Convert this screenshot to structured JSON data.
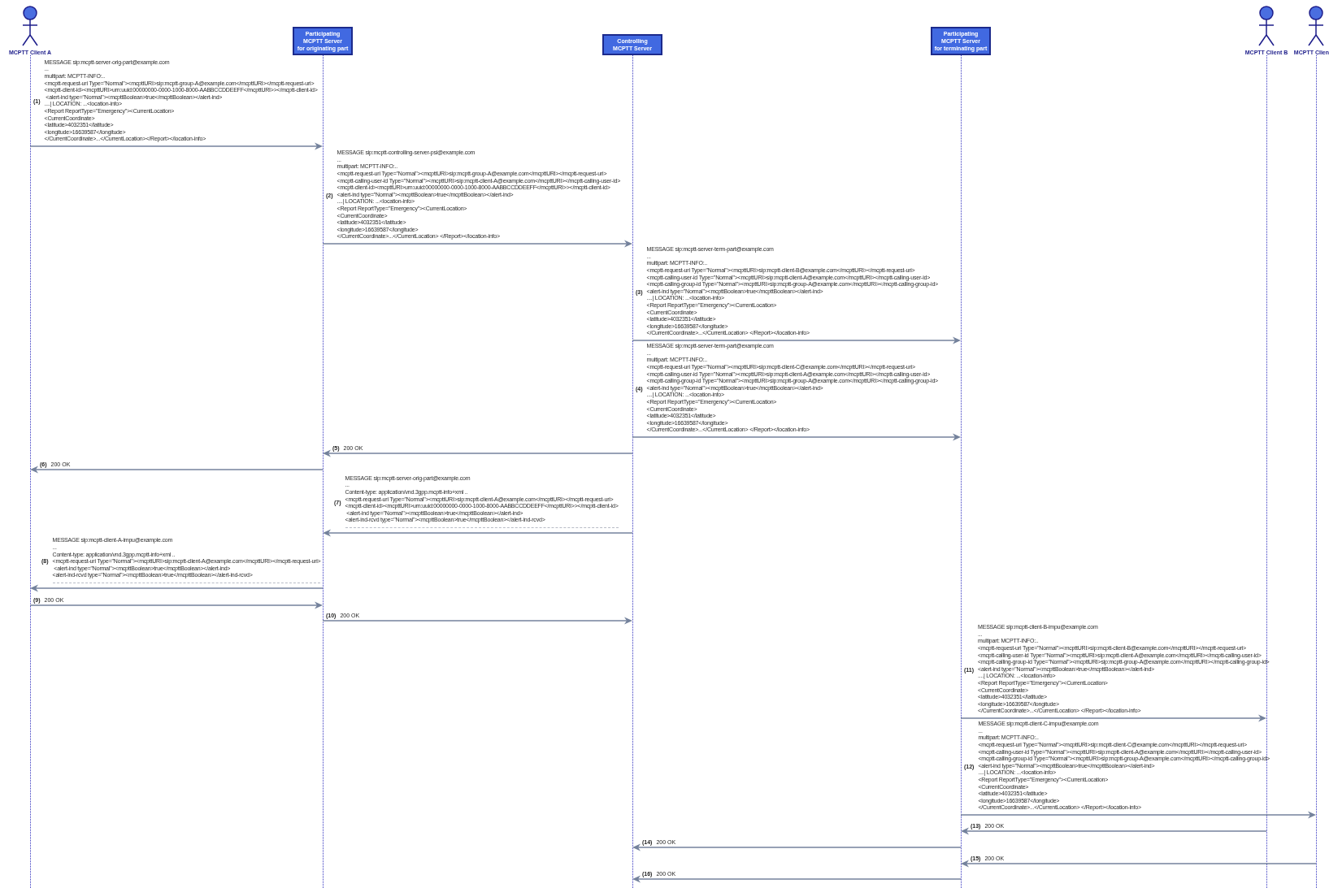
{
  "participants": [
    {
      "kind": "actor",
      "label_lines": [
        "MCPTT Client A"
      ]
    },
    {
      "kind": "server",
      "label_lines": [
        "Participating",
        "MCPTT Server",
        "for originating part"
      ]
    },
    {
      "kind": "server",
      "label_lines": [
        "Controlling",
        "MCPTT Server"
      ]
    },
    {
      "kind": "server",
      "label_lines": [
        "Participating",
        "MCPTT Server",
        "for terminating part"
      ]
    },
    {
      "kind": "actor",
      "label_lines": [
        "MCPTT Client B"
      ]
    },
    {
      "kind": "actor",
      "label_lines": [
        "MCPTT Clien"
      ]
    }
  ],
  "messages": [
    {
      "kind": "body",
      "number": "(1)",
      "cut_off": false,
      "lines": [
        "MESSAGE sip:mcptt-server-orig-part@example.com",
        "...",
        "multipart: MCPTT-INFO:..",
        "<mcptt-request-uri Type=\"Normal\"><mcpttURI>sip:mcptt-group-A@example.com</mcpttURI></mcptt-request-uri>",
        "<mcptt-client-id><mcpttURI>urn:uuid:00000000-0000-1000-8000-AABBCCDDEEFF</mcpttURI>></mcptt-client-id>",
        " <alert-ind type=\"Normal\"><mcpttBoolean>true</mcpttBoolean></alert-ind>",
        "....| LOCATION: ...<location-info>",
        "<Report ReportType=\"Emergency\"><CurrentLocation>",
        "<CurrentCoordinate>",
        "<latitude>4032351</latitude>",
        "<longitude>16639587</longitude>",
        "</CurrentCoordinate>...</CurrentLocation></Report></location-info>"
      ]
    },
    {
      "kind": "body",
      "number": "(2)",
      "cut_off": false,
      "lines": [
        "MESSAGE sip:mcptt-controlling-server-psi@example.com",
        "...",
        "multipart: MCPTT-INFO:..",
        "<mcptt-request-uri Type=\"Normal\"><mcpttURI>sip:mcptt-group-A@example.com</mcpttURI></mcptt-request-uri>",
        "<mcptt-calling-user-id Type=\"Normal\"><mcpttURI>sip:mcptt-client-A@example.com</mcpttURI></mcptt-calling-user-id>",
        "<mcptt-client-id><mcpttURI>urn:uuid:00000000-0000-1000-8000-AABBCCDDEEFF</mcpttURI>></mcptt-client-id>",
        "<alert-ind type=\"Normal\"><mcpttBoolean>true</mcpttBoolean></alert-ind>",
        "....| LOCATION: ...<location-info>",
        "<Report ReportType=\"Emergency\"><CurrentLocation>",
        "<CurrentCoordinate>",
        "<latitude>4032351</latitude>",
        "<longitude>16639587</longitude>",
        "</CurrentCoordinate>...</CurrentLocation> </Report></location-info>"
      ]
    },
    {
      "kind": "body",
      "number": "(3)",
      "cut_off": false,
      "lines": [
        "MESSAGE sip:mcptt-server-term-part@example.com",
        "...",
        "multipart: MCPTT-INFO:..",
        "<mcptt-request-uri Type=\"Normal\"><mcpttURI>sip:mcptt-client-B@example.com</mcpttURI></mcptt-request-uri>",
        "<mcptt-calling-user-id Type=\"Normal\"><mcpttURI>sip:mcptt-client-A@example.com</mcpttURI></mcptt-calling-user-id>",
        "<mcptt-calling-group-id Type=\"Normal\"><mcpttURI>sip:mcptt-group-A@example.com</mcpttURI></mcptt-calling-group-id>",
        "<alert-ind type=\"Normal\"><mcpttBoolean>true</mcpttBoolean></alert-ind>",
        "....| LOCATION: ...<location-info>",
        "<Report ReportType=\"Emergency\"><CurrentLocation>",
        "<CurrentCoordinate>",
        "<latitude>4032351</latitude>",
        "<longitude>16639587</longitude>",
        "</CurrentCoordinate>...</CurrentLocation> </Report></location-info>"
      ]
    },
    {
      "kind": "body",
      "number": "(4)",
      "cut_off": false,
      "lines": [
        "MESSAGE sip:mcptt-server-term-part@example.com",
        "...",
        "multipart: MCPTT-INFO:..",
        "<mcptt-request-uri Type=\"Normal\"><mcpttURI>sip:mcptt-client-C@example.com</mcpttURI></mcptt-request-uri>",
        "<mcptt-calling-user-id Type=\"Normal\"><mcpttURI>sip:mcptt-client-A@example.com</mcpttURI></mcptt-calling-user-id>",
        "<mcptt-calling-group-id Type=\"Normal\"><mcpttURI>sip:mcptt-group-A@example.com</mcpttURI></mcptt-calling-group-id>",
        "<alert-ind type=\"Normal\"><mcpttBoolean>true</mcpttBoolean></alert-ind>",
        "....| LOCATION: ...<location-info>",
        "<Report ReportType=\"Emergency\"><CurrentLocation>",
        "<CurrentCoordinate>",
        "<latitude>4032351</latitude>",
        "<longitude>16639587</longitude>",
        "</CurrentCoordinate>...</CurrentLocation> </Report></location-info>"
      ]
    },
    {
      "kind": "reply",
      "number": "(5)",
      "text": "200 OK"
    },
    {
      "kind": "reply",
      "number": "(6)",
      "text": "200 OK"
    },
    {
      "kind": "body",
      "number": "(7)",
      "cut_off": true,
      "lines": [
        "MESSAGE sip:mcptt-server-orig-part@example.com",
        "...",
        "Content-type: application/vnd.3gpp.mcptt-info+xml ..",
        "<mcptt-request-uri Type=\"Normal\"><mcpttURI>sip:mcptt-client-A@example.com</mcpttURI></mcptt-request-uri>",
        "<mcptt-client-id><mcpttURI>urn:uuid:00000000-0000-1000-8000-AABBCCDDEEFF</mcpttURI>></mcptt-client-id>",
        " <alert-ind type=\"Normal\"><mcpttBoolean>true</mcpttBoolean></alert-ind>",
        "<alert-ind-rcvd type=\"Normal\"><mcpttBoolean>true</mcpttBoolean></alert-ind-rcvd>"
      ]
    },
    {
      "kind": "body",
      "number": "(8)",
      "cut_off": true,
      "lines": [
        "MESSAGE sip:mcptt-client-A-impu@example.com",
        "...",
        "Content-type: application/vnd.3gpp.mcptt-info+xml ..",
        "<mcptt-request-uri Type=\"Normal\"><mcpttURI>sip:mcptt-client-A@example.com</mcpttURI></mcptt-request-uri>",
        " <alert-ind type=\"Normal\"><mcpttBoolean>true</mcpttBoolean></alert-ind>",
        "<alert-ind-rcvd type=\"Normal\"><mcpttBoolean>true</mcpttBoolean></alert-ind-rcvd>"
      ]
    },
    {
      "kind": "reply",
      "number": "(9)",
      "text": "200 OK"
    },
    {
      "kind": "reply",
      "number": "(10)",
      "text": "200 OK"
    },
    {
      "kind": "body",
      "number": "(11)",
      "cut_off": false,
      "lines": [
        "MESSAGE sip:mcptt-client-B-impu@example.com",
        "...",
        "multipart: MCPTT-INFO:..",
        "<mcptt-request-uri Type=\"Normal\"><mcpttURI>sip:mcptt-client-B@example.com</mcpttURI></mcptt-request-uri>",
        "<mcptt-calling-user-id Type=\"Normal\"><mcpttURI>sip:mcptt-client-A@example.com</mcpttURI></mcptt-calling-user-id>",
        "<mcptt-calling-group-id Type=\"Normal\"><mcpttURI>sip:mcptt-group-A@example.com</mcpttURI></mcptt-calling-group-id>",
        "<alert-ind type=\"Normal\"><mcpttBoolean>true</mcpttBoolean></alert-ind>",
        "....| LOCATION: ...<location-info>",
        "<Report ReportType=\"Emergency\"><CurrentLocation>",
        "<CurrentCoordinate>",
        "<latitude>4032351</latitude>",
        "<longitude>16639587</longitude>",
        "</CurrentCoordinate>...</CurrentLocation> </Report></location-info>"
      ]
    },
    {
      "kind": "body",
      "number": "(12)",
      "cut_off": false,
      "lines": [
        "MESSAGE sip:mcptt-client-C-impu@example.com",
        "...",
        "multipart: MCPTT-INFO:..",
        "<mcptt-request-uri Type=\"Normal\"><mcpttURI>sip:mcptt-client-C@example.com</mcpttURI></mcptt-request-uri>",
        "<mcptt-calling-user-id Type=\"Normal\"><mcpttURI>sip:mcptt-client-A@example.com</mcpttURI></mcptt-calling-user-id>",
        "<mcptt-calling-group-id Type=\"Normal\"><mcpttURI>sip:mcptt-group-A@example.com</mcpttURI></mcptt-calling-group-id>",
        "<alert-ind type=\"Normal\"><mcpttBoolean>true</mcpttBoolean></alert-ind>",
        "....| LOCATION: ...<location-info>",
        "<Report ReportType=\"Emergency\"><CurrentLocation>",
        "<CurrentCoordinate>",
        "<latitude>4032351</latitude>",
        "<longitude>16639587</longitude>",
        "</CurrentCoordinate>...</CurrentLocation> </Report></location-info>"
      ]
    },
    {
      "kind": "reply",
      "number": "(13)",
      "text": "200 OK"
    },
    {
      "kind": "reply",
      "number": "(14)",
      "text": "200 OK"
    },
    {
      "kind": "reply",
      "number": "(15)",
      "text": "200 OK"
    },
    {
      "kind": "reply",
      "number": "(16)",
      "text": "200 OK"
    }
  ]
}
